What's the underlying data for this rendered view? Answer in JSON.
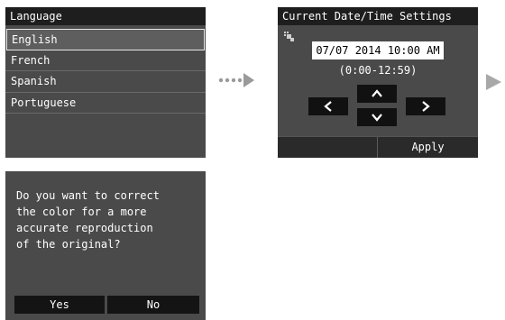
{
  "language_screen": {
    "title": "Language",
    "items": [
      "English",
      "French",
      "Spanish",
      "Portuguese"
    ],
    "selected": "English"
  },
  "datetime_screen": {
    "title": "Current Date/Time Settings",
    "date_value": "07/07 2014 10:00 AM",
    "range_hint": "(0:00-12:59)",
    "apply_label": "Apply"
  },
  "dialog_screen": {
    "message_lines": [
      "Do you want to correct",
      "the color for a more",
      "accurate reproduction",
      "of the original?"
    ],
    "yes_label": "Yes",
    "no_label": "No"
  },
  "icons": {
    "flow_dots": "dotted-arrow-icon",
    "next_arrow": "right-triangle-icon",
    "clock": "clock-settings-icon"
  },
  "colors": {
    "screen_bg": "#4a4a4a",
    "titlebar_bg": "#1e1e1e",
    "button_bg": "#111111",
    "arrow_gray": "#a8a8a8"
  }
}
